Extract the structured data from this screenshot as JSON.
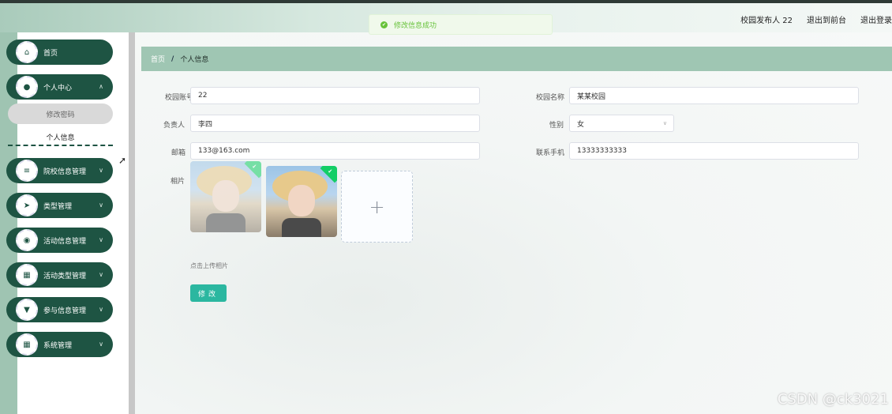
{
  "header": {
    "title": "",
    "user_label": "校园发布人 22",
    "front_label": "退出到前台",
    "logout_label": "退出登录"
  },
  "toast": {
    "message": "修改信息成功"
  },
  "sidebar": {
    "items": [
      {
        "label": "首页",
        "icon": "home-icon"
      },
      {
        "label": "个人中心",
        "icon": "user-icon"
      },
      {
        "label": "院校信息管理",
        "icon": "sliders-icon"
      },
      {
        "label": "类型管理",
        "icon": "send-icon"
      },
      {
        "label": "活动信息管理",
        "icon": "pin-icon"
      },
      {
        "label": "活动类型管理",
        "icon": "grid-icon"
      },
      {
        "label": "参与信息管理",
        "icon": "flag-icon"
      },
      {
        "label": "系统管理",
        "icon": "grid-icon"
      }
    ],
    "sub_items": [
      {
        "label": "修改密码"
      },
      {
        "label": "个人信息"
      }
    ]
  },
  "breadcrumb": {
    "home": "首页",
    "sep": "/",
    "current": "个人信息"
  },
  "form": {
    "account_label": "校园账号",
    "account_value": "22",
    "campus_label": "校园名称",
    "campus_value": "某某校园",
    "manager_label": "负责人",
    "manager_value": "李四",
    "gender_label": "性别",
    "gender_value": "女",
    "email_label": "邮箱",
    "email_value": "133@163.com",
    "phone_label": "联系手机",
    "phone_value": "13333333333",
    "photo_label": "相片",
    "upload_hint": "点击上传相片",
    "submit_label": "修改"
  },
  "watermark": "CSDN @ck3021",
  "colors": {
    "menu": "#1e5443",
    "breadcrumb": "#9fc6b3",
    "button": "#2bb7a0"
  }
}
